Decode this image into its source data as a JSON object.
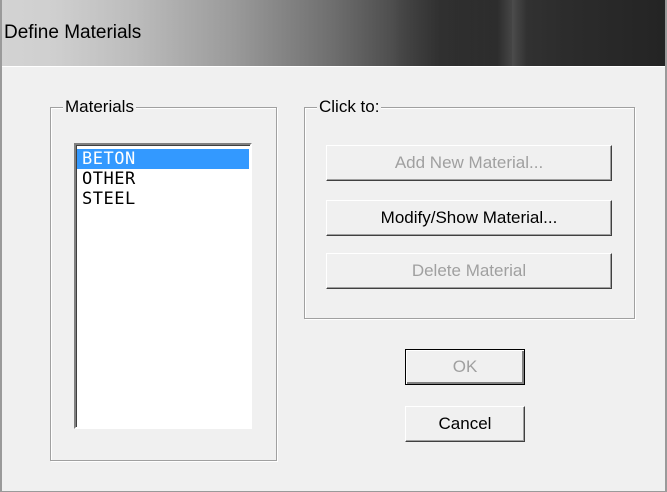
{
  "window": {
    "title": "Define Materials"
  },
  "materials_group": {
    "label": "Materials",
    "items": [
      {
        "label": "BETON",
        "selected": true
      },
      {
        "label": "OTHER",
        "selected": false
      },
      {
        "label": "STEEL",
        "selected": false
      }
    ]
  },
  "actions_group": {
    "label": "Click to:",
    "add_label": "Add New Material...",
    "modify_label": "Modify/Show Material...",
    "delete_label": "Delete Material"
  },
  "dialog_buttons": {
    "ok_label": "OK",
    "cancel_label": "Cancel"
  },
  "colors": {
    "selection": "#3399ff",
    "disabled_text": "#a0a0a0"
  }
}
